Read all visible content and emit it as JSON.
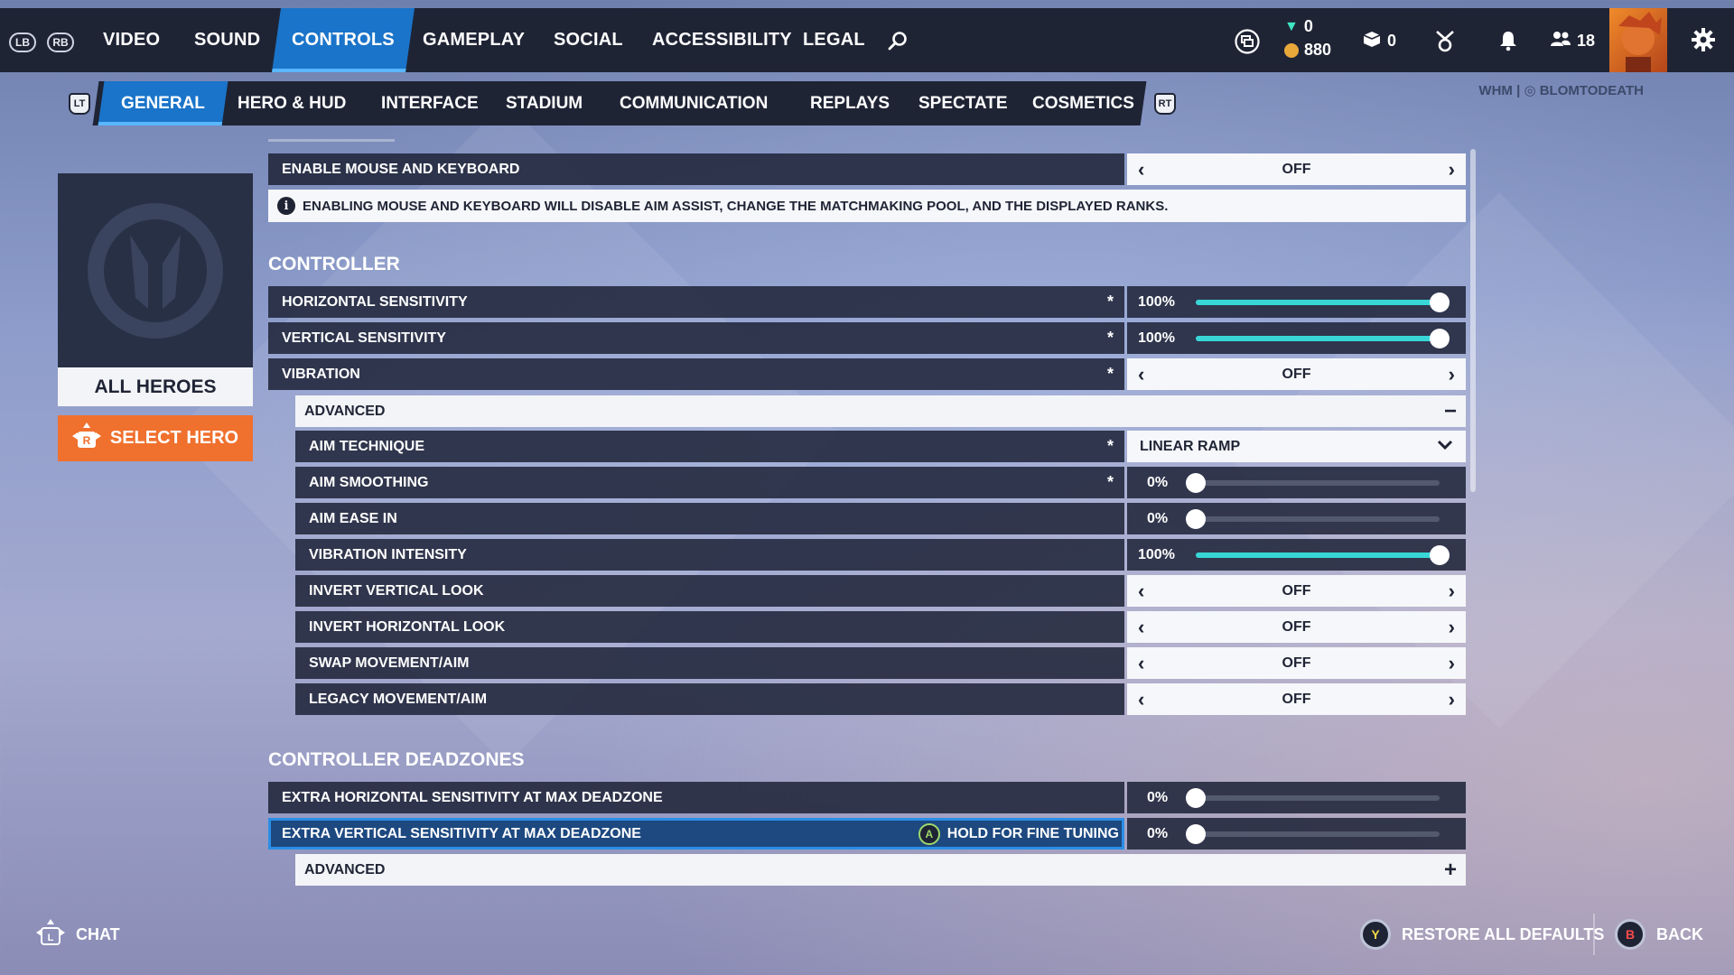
{
  "top_nav": {
    "left_bumper": "LB",
    "right_bumper": "RB",
    "tabs": [
      {
        "label": "VIDEO"
      },
      {
        "label": "SOUND"
      },
      {
        "label": "CONTROLS"
      },
      {
        "label": "GAMEPLAY"
      },
      {
        "label": "SOCIAL"
      },
      {
        "label": "ACCESSIBILITY"
      },
      {
        "label": "LEGAL"
      }
    ],
    "active_tab": "CONTROLS",
    "legacy_credits": "0",
    "coins": "880",
    "lootboxes": "0",
    "friends_count": "18"
  },
  "sub_nav": {
    "left_trigger": "LT",
    "right_trigger": "RT",
    "tabs": [
      {
        "label": "GENERAL"
      },
      {
        "label": "HERO & HUD"
      },
      {
        "label": "INTERFACE"
      },
      {
        "label": "STADIUM"
      },
      {
        "label": "COMMUNICATION"
      },
      {
        "label": "REPLAYS"
      },
      {
        "label": "SPECTATE"
      },
      {
        "label": "COSMETICS"
      }
    ],
    "active_tab": "GENERAL",
    "account_prefix": "WHM |",
    "account_name": "BLOMTODEATH"
  },
  "hero_panel": {
    "name": "ALL HEROES",
    "select_label": "SELECT HERO"
  },
  "settings": {
    "mouse_keyboard": {
      "label": "ENABLE MOUSE AND KEYBOARD",
      "value": "OFF"
    },
    "info_text": "ENABLING MOUSE AND KEYBOARD WILL DISABLE AIM ASSIST, CHANGE THE MATCHMAKING POOL, AND THE DISPLAYED RANKS.",
    "controller_heading": "CONTROLLER",
    "horizontal_sensitivity": {
      "label": "HORIZONTAL SENSITIVITY",
      "value": "100%",
      "level": 1.0
    },
    "vertical_sensitivity": {
      "label": "VERTICAL SENSITIVITY",
      "value": "100%",
      "level": 1.0
    },
    "vibration": {
      "label": "VIBRATION",
      "value": "OFF"
    },
    "advanced_1": {
      "label": "ADVANCED",
      "symbol": "−"
    },
    "aim_technique": {
      "label": "AIM TECHNIQUE",
      "value": "LINEAR RAMP"
    },
    "aim_smoothing": {
      "label": "AIM SMOOTHING",
      "value": "0%",
      "level": 0.0
    },
    "aim_ease_in": {
      "label": "AIM EASE IN",
      "value": "0%",
      "level": 0.0
    },
    "vibration_intensity": {
      "label": "VIBRATION INTENSITY",
      "value": "100%",
      "level": 1.0
    },
    "invert_vertical": {
      "label": "INVERT VERTICAL LOOK",
      "value": "OFF"
    },
    "invert_horizontal": {
      "label": "INVERT HORIZONTAL LOOK",
      "value": "OFF"
    },
    "swap_movement": {
      "label": "SWAP MOVEMENT/AIM",
      "value": "OFF"
    },
    "legacy_movement": {
      "label": "LEGACY MOVEMENT/AIM",
      "value": "OFF"
    },
    "deadzones_heading": "CONTROLLER DEADZONES",
    "extra_horizontal": {
      "label": "EXTRA HORIZONTAL SENSITIVITY AT MAX DEADZONE",
      "value": "0%",
      "level": 0.0
    },
    "extra_vertical": {
      "label": "EXTRA VERTICAL SENSITIVITY AT MAX DEADZONE",
      "value": "0%",
      "level": 0.0,
      "hint_button": "A",
      "hint": "HOLD FOR FINE TUNING"
    },
    "advanced_2": {
      "label": "ADVANCED",
      "symbol": "+"
    },
    "star": "*"
  },
  "bottom_bar": {
    "chat_label": "CHAT",
    "restore_button": "Y",
    "restore_label": "RESTORE ALL DEFAULTS",
    "back_button": "B",
    "back_label": "BACK"
  }
}
